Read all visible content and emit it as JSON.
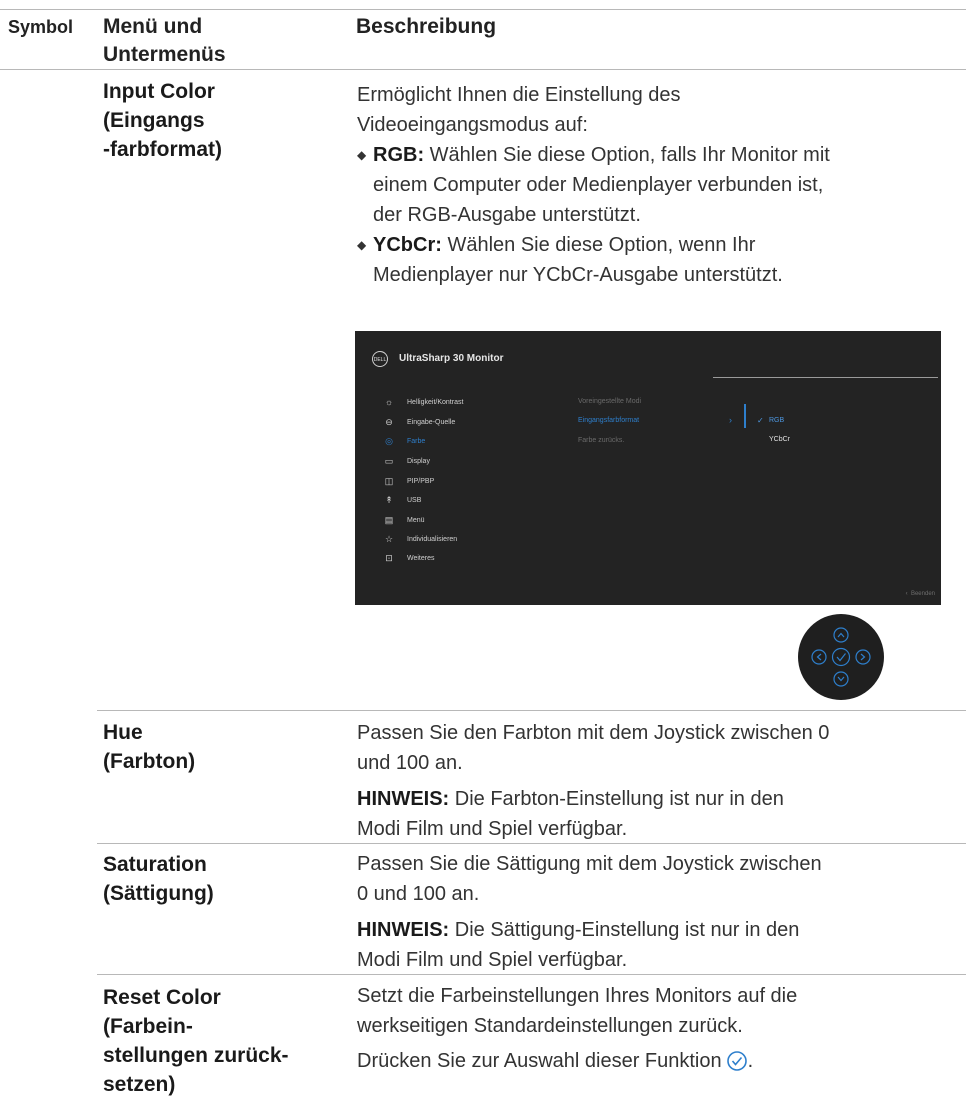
{
  "header": {
    "symbol": "Symbol",
    "menu": "Menü und\nUntermenüs",
    "description": "Beschreibung"
  },
  "rows": [
    {
      "menu": "Input Color\n(Eingangs\n-farbformat)",
      "intro": "Ermöglicht Ihnen die Einstellung des\nVideoeingangsmodus auf:",
      "bullets": [
        {
          "term": "RGB:",
          "text": " Wählen Sie diese Option, falls Ihr Monitor mit\neinem Computer oder Medienplayer verbunden ist,\nder RGB-Ausgabe unterstützt."
        },
        {
          "term": "YCbCr:",
          "text": " Wählen Sie diese Option, wenn Ihr\nMedienplayer nur YCbCr-Ausgabe unterstützt."
        }
      ]
    },
    {
      "menu": "Hue\n(Farbton)",
      "text": "Passen Sie den Farbton mit dem Joystick zwischen 0\nund 100 an.",
      "note_label": "HINWEIS:",
      "note": " Die Farbton-Einstellung ist nur in den\nModi Film und Spiel verfügbar."
    },
    {
      "menu": "Saturation\n(Sättigung)",
      "text": "Passen Sie die Sättigung mit dem Joystick zwischen\n0 und 100 an.",
      "note_label": "HINWEIS:",
      "note": " Die Sättigung-Einstellung ist nur in den\nModi Film und Spiel verfügbar."
    },
    {
      "menu": "Reset Color\n(Farbein-\nstellungen zurück-\nsetzen)",
      "text": "Setzt die Farbeinstellungen Ihres Monitors auf die\nwerkseitigen Standardeinstellungen zurück.",
      "text2": "Drücken Sie zur Auswahl dieser Funktion "
    }
  ],
  "osd": {
    "logo": "DELL",
    "title": "UltraSharp 30 Monitor",
    "menu_items": [
      {
        "label": "Helligkeit/Kontrast",
        "icon": "sun-icon"
      },
      {
        "label": "Eingabe-Quelle",
        "icon": "input-source-icon"
      },
      {
        "label": "Farbe",
        "icon": "palette-icon",
        "active": true
      },
      {
        "label": "Display",
        "icon": "display-icon"
      },
      {
        "label": "PIP/PBP",
        "icon": "pip-icon"
      },
      {
        "label": "USB",
        "icon": "usb-icon"
      },
      {
        "label": "Menü",
        "icon": "menu-icon"
      },
      {
        "label": "Individualisieren",
        "icon": "star-icon"
      },
      {
        "label": "Weiteres",
        "icon": "other-icon"
      }
    ],
    "submenu": [
      {
        "label": "Voreingestellte Modi"
      },
      {
        "label": "Eingangsfarbformat",
        "active": true
      },
      {
        "label": "Farbe zurücks."
      }
    ],
    "options": [
      {
        "label": "RGB",
        "selected": true
      },
      {
        "label": "YCbCr"
      }
    ],
    "footer": "Beenden",
    "accent_color": "#2e7fcc"
  }
}
